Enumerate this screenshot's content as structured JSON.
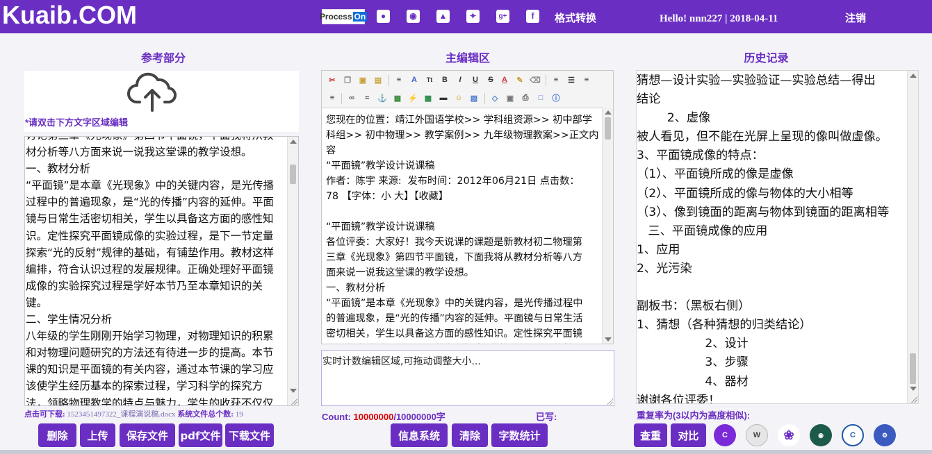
{
  "header": {
    "brand": "Kuaib.COM",
    "processon_a": "Process",
    "processon_b": "On",
    "format_convert": "格式转换",
    "greeting": "Hello!  nnn227 | 2018-04-11",
    "logout": "注销"
  },
  "left": {
    "title": "参考部分",
    "upload_hint": "*请双击下方文字区域编辑",
    "text": "讨论第三章《光现象》第四节平面镜，下面我将从教\n材分析等八方面来说一说我这堂课的教学设想。\n一、教材分析\n“平面镜”是本章《光现象》中的关键内容，是光传播\n过程中的普遍现象，是“光的传播”内容的延伸。平面\n镜与日常生活密切相关，学生以具备这方面的感性知\n识。定性探究平面镜成像的实验过程，是下一节定量\n探索“光的反射”规律的基础，有铺垫作用。教材这样\n编排，符合认识过程的发展规律。正确处理好平面镜\n成像的实验探究过程是学好本节乃至本章知识的关\n键。\n二、学生情况分析\n八年级的学生刚刚开始学习物理，对物理知识的积累\n和对物理问题研究的方法还有待进一步的提高。本节\n课的知识是平面镜的有关内容，通过本节课的学习应\n该使学生经历基本的探索过程，学习科学的探究方\n法，领略物理教学的特点与魅力，学生的收获不仅仅",
    "download_label": "点击可下载:",
    "filename": "1523451497322_课程演说稿.docx",
    "filecount_label": "系统文件总个数:",
    "filecount": "19",
    "buttons": [
      "删除",
      "上传",
      "保存文件",
      "pdf文件",
      "下载文件"
    ]
  },
  "middle": {
    "title": "主编辑区",
    "editor_text": "您现在的位置：靖江外国语学校>> 学科组资源>> 初中部学\n科组>> 初中物理>> 教学案例>> 九年级物理教案>>正文内\n容\n“平面镜”教学设计说课稿\n作者：陈宇 来源:  发布时间：2012年06月21日 点击数：\n78 【字体：小 大】【收藏】\n\n“平面镜”教学设计说课稿\n各位评委：大家好！我今天说课的课题是新教材初二物理第\n三章《光现象》第四节平面镜，下面我将从教材分析等八方\n面来说一说我这堂课的教学设想。\n一、教材分析\n“平面镜”是本章《光现象》中的关键内容，是光传播过程中\n的普遍现象，是“光的传播”内容的延伸。平面镜与日常生活\n密切相关，学生以具备这方面的感性知识。定性探究平面镜\n成像的实验过程，是下一节定量探索“光的反射”规律的基",
    "counter_placeholder": "实时计数编辑区域,可拖动调整大小...",
    "count_label": "Count:",
    "count_value": "10000000",
    "count_total": "/10000000字",
    "written_label": "已写:",
    "buttons": [
      "信息系统",
      "清除",
      "字数统计"
    ]
  },
  "right": {
    "title": "历史记录",
    "text": "猜想—设计实验—实验验证—实验总结—得出\n结论\n        2、虚像\n被人看见，但不能在光屏上呈现的像叫做虚像。\n3、平面镜成像的特点：\n（1）、平面镜所成的像是虚像\n（2）、平面镜所成的像与物体的大小相等\n（3）、像到镜面的距离与物体到镜面的距离相等\n   三、平面镜成像的应用\n1、应用\n2、光污染\n\n副板书：（黑板右侧）\n1、猜想（各种猜想的归类结论）\n                  2、设计\n                  3、步骤\n                  4、器材\n谢谢各位评委！",
    "dup_label": "重复率为(3以内为高度相似):",
    "buttons": [
      "查重",
      "对比"
    ]
  },
  "colors": {
    "accent": "#6a2fc2",
    "count_red": "#dd0000"
  }
}
